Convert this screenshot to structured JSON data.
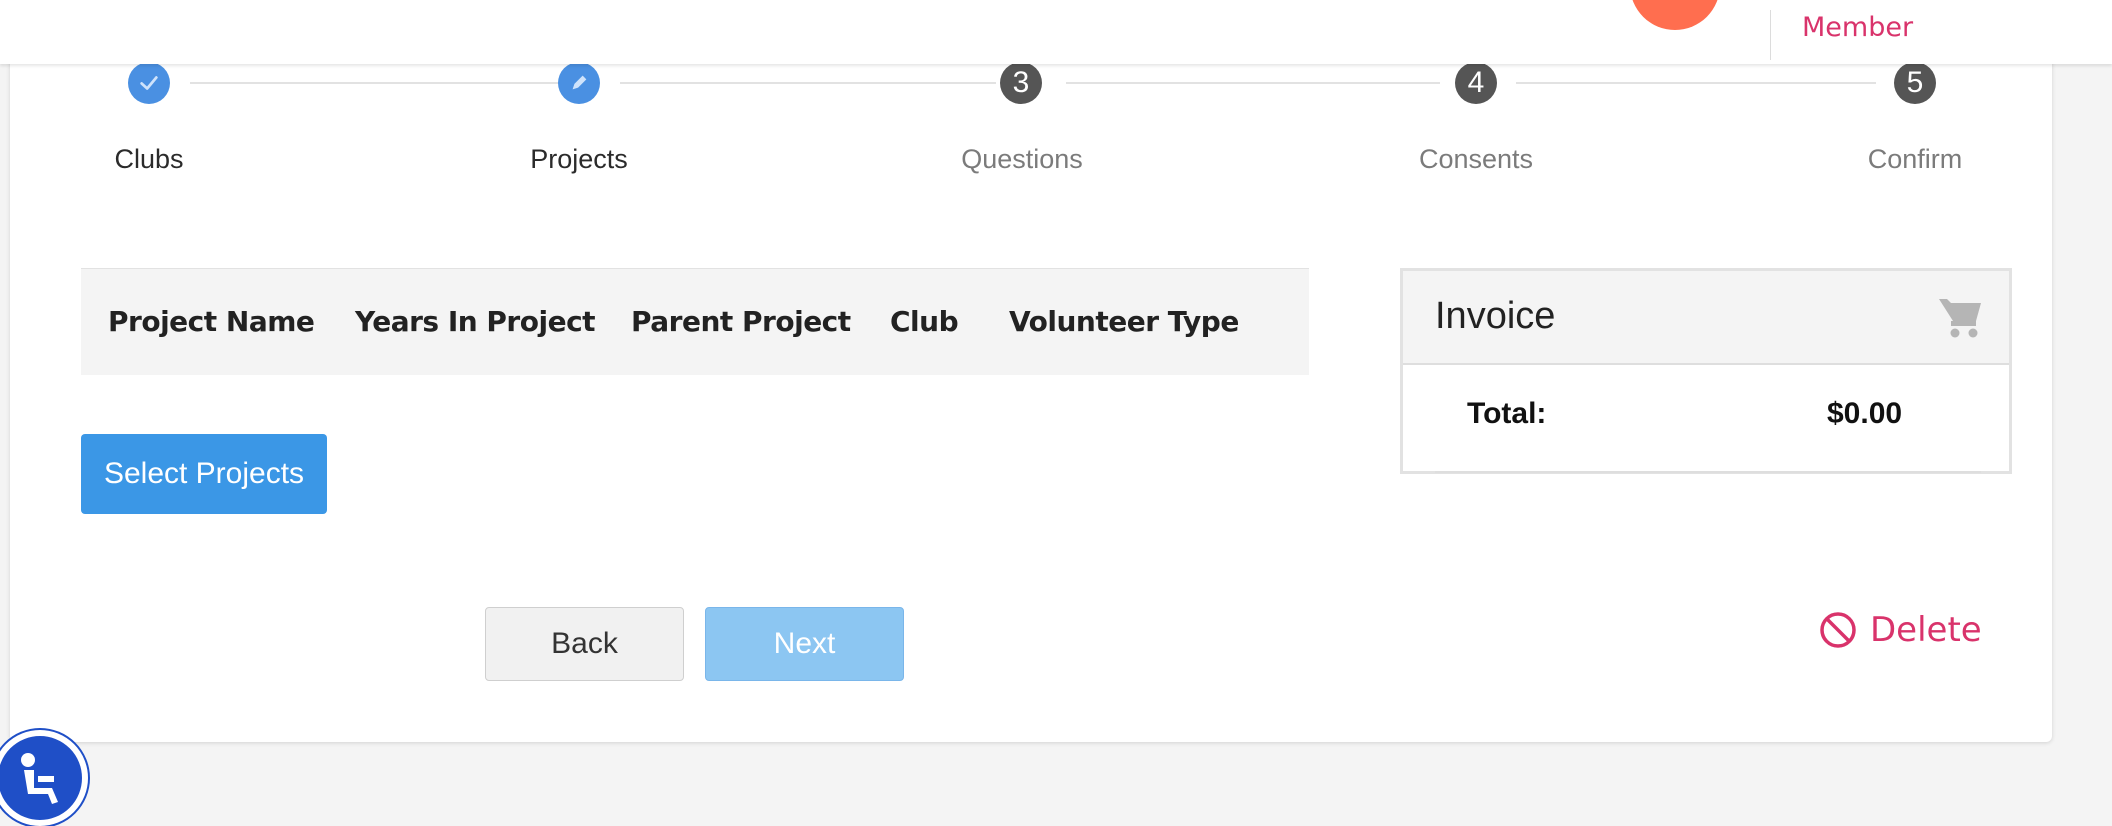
{
  "header": {
    "member_label": "Member"
  },
  "stepper": {
    "steps": [
      {
        "label": "Clubs",
        "state": "completed",
        "icon": "check-icon"
      },
      {
        "label": "Projects",
        "state": "current",
        "icon": "pencil-icon"
      },
      {
        "label": "Questions",
        "number": "3",
        "state": "upcoming"
      },
      {
        "label": "Consents",
        "number": "4",
        "state": "upcoming"
      },
      {
        "label": "Confirm",
        "number": "5",
        "state": "upcoming"
      }
    ]
  },
  "projects_table": {
    "columns": [
      "Project Name",
      "Years In Project",
      "Parent Project",
      "Club",
      "Volunteer Type"
    ],
    "rows": []
  },
  "actions": {
    "select_projects_label": "Select Projects",
    "back_label": "Back",
    "next_label": "Next",
    "delete_label": "Delete"
  },
  "invoice": {
    "title": "Invoice",
    "total_label": "Total:",
    "total_value": "$0.00"
  },
  "colors": {
    "accent_blue": "#3b97e6",
    "step_done": "#4a90e2",
    "step_todo": "#555555",
    "danger_pink": "#d9336b",
    "avatar_orange": "#ff6e4f"
  },
  "icons": {
    "cart": "shopping-cart-icon",
    "delete": "ban-icon",
    "accessibility": "accessibility-icon"
  }
}
